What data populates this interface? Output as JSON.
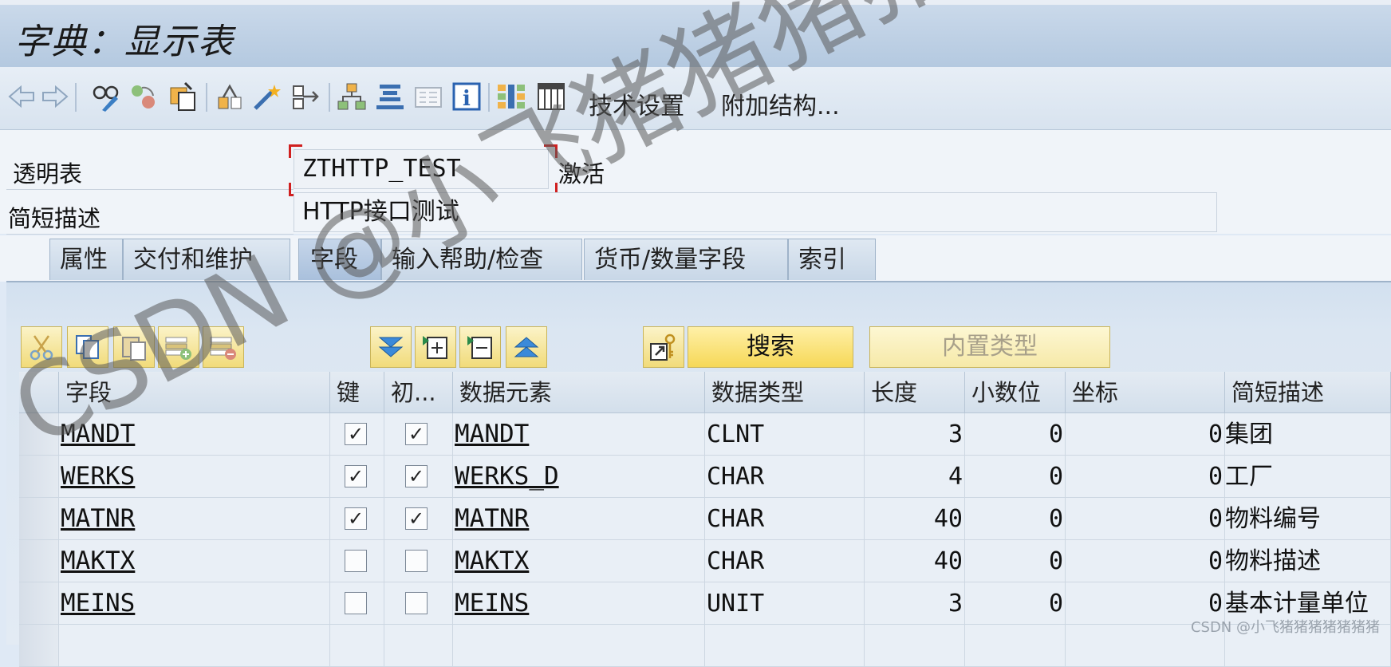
{
  "window": {
    "title": "字典：显示表"
  },
  "toolbar": {
    "icons": [
      "back-icon",
      "forward-icon",
      "display-change-icon",
      "other-object-icon",
      "object-list-icon",
      "check-icon",
      "activate-icon",
      "where-used-icon",
      "hierarchy-icon",
      "object-directory-icon",
      "documentation-icon",
      "info-icon",
      "layout-icon",
      "table-view-icon"
    ],
    "tech_settings": "技术设置",
    "append_structure": "附加结构..."
  },
  "header": {
    "table_label": "透明表",
    "table_name": "ZTHTTP_TEST",
    "status": "激活",
    "desc_label": "简短描述",
    "desc_value": "HTTP接口测试"
  },
  "tabs": [
    {
      "label": "属性",
      "active": false
    },
    {
      "label": "交付和维护",
      "active": false
    },
    {
      "label": "字段",
      "active": true
    },
    {
      "label": "输入帮助/检查",
      "active": false
    },
    {
      "label": "货币/数量字段",
      "active": false
    },
    {
      "label": "索引",
      "active": false
    }
  ],
  "field_toolbar": {
    "search_label": "搜索",
    "builtin_type_label": "内置类型"
  },
  "table": {
    "columns": [
      "字段",
      "键",
      "初...",
      "数据元素",
      "数据类型",
      "长度",
      "小数位",
      "坐标",
      "简短描述"
    ],
    "rows": [
      {
        "field": "MANDT",
        "key": true,
        "init": true,
        "element": "MANDT",
        "type": "CLNT",
        "length": "3",
        "decimals": "0",
        "coord": "0",
        "desc": "集团"
      },
      {
        "field": "WERKS",
        "key": true,
        "init": true,
        "element": "WERKS_D",
        "type": "CHAR",
        "length": "4",
        "decimals": "0",
        "coord": "0",
        "desc": "工厂"
      },
      {
        "field": "MATNR",
        "key": true,
        "init": true,
        "element": "MATNR",
        "type": "CHAR",
        "length": "40",
        "decimals": "0",
        "coord": "0",
        "desc": "物料编号"
      },
      {
        "field": "MAKTX",
        "key": false,
        "init": false,
        "element": "MAKTX",
        "type": "CHAR",
        "length": "40",
        "decimals": "0",
        "coord": "0",
        "desc": "物料描述"
      },
      {
        "field": "MEINS",
        "key": false,
        "init": false,
        "element": "MEINS",
        "type": "UNIT",
        "length": "3",
        "decimals": "0",
        "coord": "0",
        "desc": "基本计量单位"
      }
    ]
  },
  "watermark": {
    "text": "CSDN @小飞猪猪猪猪猪猪",
    "credit": "CSDN @小飞猪猪猪猪猪猪猪"
  },
  "colors": {
    "accent": "#f6d857",
    "focus": "#d02020"
  }
}
